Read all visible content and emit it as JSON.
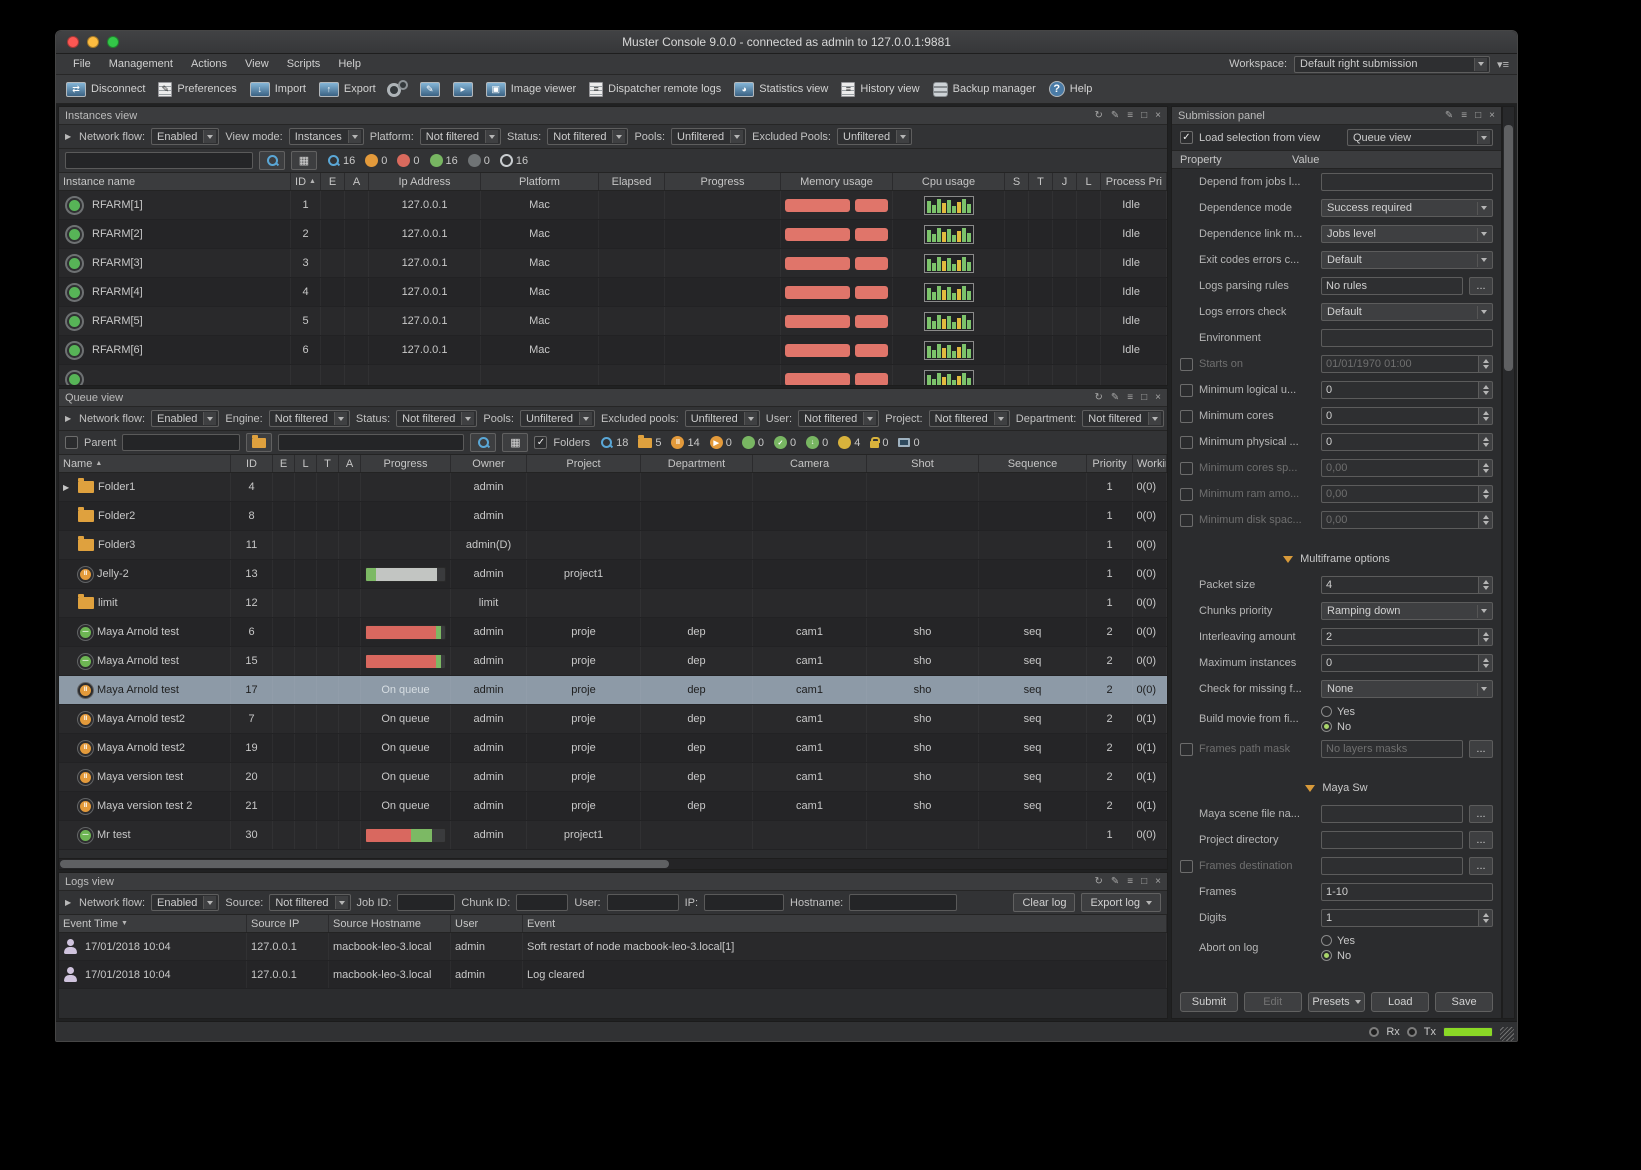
{
  "window": {
    "title": "Muster Console 9.0.0 - connected as admin to 127.0.0.1:9881"
  },
  "colors": {
    "accent_blue": "#5aa7d6",
    "green": "#78b662",
    "yellow": "#e2bb3f",
    "orange": "#dfa13e",
    "red_bar": "#e0756a",
    "progress_red": "#d9685f",
    "selected_row": "#8d9aa7",
    "tx_green": "#8ad926"
  },
  "menubar": {
    "items": [
      "File",
      "Management",
      "Actions",
      "View",
      "Scripts",
      "Help"
    ],
    "workspace_label": "Workspace:",
    "workspace_value": "Default right submission"
  },
  "toolbar": {
    "items": [
      {
        "name": "disconnect",
        "label": "Disconnect",
        "kind": "mon",
        "glyph": "⇄"
      },
      {
        "name": "preferences",
        "label": "Preferences",
        "kind": "page",
        "glyph": "✎"
      },
      {
        "name": "import",
        "label": "Import",
        "kind": "mon",
        "glyph": "↓"
      },
      {
        "name": "export",
        "label": "Export",
        "kind": "mon",
        "glyph": "↑"
      },
      {
        "name": "engine-settings",
        "label": "",
        "kind": "gears",
        "glyph": ""
      },
      {
        "name": "node-editor",
        "label": "",
        "kind": "mon",
        "glyph": "✎"
      },
      {
        "name": "send-command",
        "label": "",
        "kind": "mon",
        "glyph": "▸"
      },
      {
        "name": "image-viewer",
        "label": "Image viewer",
        "kind": "mon",
        "glyph": "▣"
      },
      {
        "name": "dispatcher-remote-logs",
        "label": "Dispatcher remote logs",
        "kind": "page",
        "glyph": "≡"
      },
      {
        "name": "statistics-view",
        "label": "Statistics view",
        "kind": "mon",
        "glyph": "◕"
      },
      {
        "name": "history-view",
        "label": "History view",
        "kind": "page",
        "glyph": "≡"
      },
      {
        "name": "backup-manager",
        "label": "Backup manager",
        "kind": "disks",
        "glyph": ""
      },
      {
        "name": "help",
        "label": "Help",
        "kind": "helpc",
        "glyph": "?"
      }
    ]
  },
  "header_icons": {
    "left_panels": [
      [
        "refresh",
        "↻"
      ],
      [
        "tools",
        "✎"
      ],
      [
        "menu",
        "≡"
      ],
      [
        "maximize",
        "□"
      ],
      [
        "close",
        "×"
      ]
    ],
    "submission": [
      [
        "tools",
        "✎"
      ],
      [
        "menu",
        "≡"
      ],
      [
        "maximize",
        "□"
      ],
      [
        "close",
        "×"
      ]
    ]
  },
  "instances_visuals": {
    "memory_bars": [
      68,
      34
    ],
    "cpu_bars": [
      [
        12,
        "g"
      ],
      [
        8,
        "g"
      ],
      [
        14,
        "g"
      ],
      [
        10,
        "y"
      ],
      [
        13,
        "g"
      ],
      [
        7,
        "g"
      ],
      [
        11,
        "y"
      ],
      [
        14,
        "g"
      ],
      [
        9,
        "g"
      ]
    ]
  },
  "panels": {
    "instances": {
      "title": "Instances view",
      "filters": [
        [
          "Network flow:",
          "Enabled"
        ],
        [
          "View mode:",
          "Instances"
        ],
        [
          "Platform:",
          "Not filtered"
        ],
        [
          "Status:",
          "Not filtered"
        ],
        [
          "Pools:",
          "Unfiltered"
        ],
        [
          "Excluded Pools:",
          "Unfiltered"
        ]
      ],
      "search_value": "",
      "counters": [
        {
          "icon": "search",
          "value": "16"
        },
        {
          "icon": "circle",
          "color": "#e39a3b",
          "value": "0"
        },
        {
          "icon": "circle",
          "color": "#d96a5d",
          "value": "0"
        },
        {
          "icon": "circle",
          "color": "#78b662",
          "value": "16"
        },
        {
          "icon": "circle",
          "color": "#6f7375",
          "value": "0"
        },
        {
          "icon": "circle-outline",
          "color": "#c9cdd0",
          "value": "16"
        }
      ],
      "columns": [
        "Instance name",
        "ID",
        "E",
        "A",
        "Ip Address",
        "Platform",
        "Elapsed",
        "Progress",
        "Memory usage",
        "Cpu usage",
        "S",
        "T",
        "J",
        "L",
        "Process Pri"
      ],
      "rows": [
        {
          "name": "RFARM[1]",
          "id": "1",
          "ip": "127.0.0.1",
          "platform": "Mac",
          "pri": "Idle"
        },
        {
          "name": "RFARM[2]",
          "id": "2",
          "ip": "127.0.0.1",
          "platform": "Mac",
          "pri": "Idle"
        },
        {
          "name": "RFARM[3]",
          "id": "3",
          "ip": "127.0.0.1",
          "platform": "Mac",
          "pri": "Idle"
        },
        {
          "name": "RFARM[4]",
          "id": "4",
          "ip": "127.0.0.1",
          "platform": "Mac",
          "pri": "Idle"
        },
        {
          "name": "RFARM[5]",
          "id": "5",
          "ip": "127.0.0.1",
          "platform": "Mac",
          "pri": "Idle"
        },
        {
          "name": "RFARM[6]",
          "id": "6",
          "ip": "127.0.0.1",
          "platform": "Mac",
          "pri": "Idle"
        },
        {
          "name": "",
          "id": "",
          "ip": "",
          "platform": "",
          "pri": "",
          "partial": true
        }
      ]
    },
    "queue": {
      "title": "Queue view",
      "filters": [
        [
          "Network flow:",
          "Enabled"
        ],
        [
          "Engine:",
          "Not filtered"
        ],
        [
          "Status:",
          "Not filtered"
        ],
        [
          "Pools:",
          "Unfiltered"
        ],
        [
          "Excluded pools:",
          "Unfiltered"
        ],
        [
          "User:",
          "Not filtered"
        ],
        [
          "Project:",
          "Not filtered"
        ],
        [
          "Department:",
          "Not filtered"
        ]
      ],
      "parent_label": "Parent",
      "folders_label": "Folders",
      "counters": [
        {
          "icon": "search",
          "value": "18"
        },
        {
          "icon": "folder",
          "value": "5"
        },
        {
          "icon": "pause",
          "color": "#e39a3b",
          "value": "14"
        },
        {
          "icon": "play",
          "color": "#e39a3b",
          "value": "0"
        },
        {
          "icon": "circle",
          "color": "#78b662",
          "value": "0"
        },
        {
          "icon": "check",
          "color": "#78b662",
          "value": "0"
        },
        {
          "icon": "down",
          "color": "#78b662",
          "value": "0"
        },
        {
          "icon": "circle",
          "color": "#d8b23c",
          "value": "4"
        },
        {
          "icon": "lock",
          "value": "0"
        },
        {
          "icon": "monitor",
          "value": "0"
        }
      ],
      "columns": [
        "Name",
        "ID",
        "E",
        "L",
        "T",
        "A",
        "Progress",
        "Owner",
        "Project",
        "Department",
        "Camera",
        "Shot",
        "Sequence",
        "Priority",
        "Working n"
      ],
      "rows": [
        {
          "icon": "folder",
          "expander": true,
          "name": "Folder1",
          "id": "4",
          "owner": "admin",
          "project": "",
          "department": "",
          "camera": "",
          "shot": "",
          "sequence": "",
          "priority": "1",
          "working": "0(0)"
        },
        {
          "icon": "folder",
          "name": "Folder2",
          "id": "8",
          "owner": "admin",
          "project": "",
          "department": "",
          "camera": "",
          "shot": "",
          "sequence": "",
          "priority": "1",
          "working": "0(0)"
        },
        {
          "icon": "folder",
          "name": "Folder3",
          "id": "11",
          "owner": "admin(D)",
          "project": "",
          "department": "",
          "camera": "",
          "shot": "",
          "sequence": "",
          "priority": "1",
          "working": "0(0)"
        },
        {
          "icon": "pause",
          "name": "Jelly-2",
          "id": "13",
          "progress": {
            "bar": [
              [
                "#7cb964",
                13
              ],
              [
                "#c2c5c2",
                77
              ]
            ]
          },
          "owner": "admin",
          "project": "project1",
          "department": "",
          "camera": "",
          "shot": "",
          "sequence": "",
          "priority": "1",
          "working": "0(0)"
        },
        {
          "icon": "folder",
          "name": "limit",
          "id": "12",
          "owner": "limit",
          "project": "",
          "department": "",
          "camera": "",
          "shot": "",
          "sequence": "",
          "priority": "1",
          "working": "0(0)"
        },
        {
          "icon": "stopped",
          "name": "Maya Arnold test",
          "id": "6",
          "progress": {
            "bar": [
              [
                "#d9685f",
                89
              ],
              [
                "#7cb964",
                6
              ]
            ]
          },
          "owner": "admin",
          "project": "proje",
          "department": "dep",
          "camera": "cam1",
          "shot": "sho",
          "sequence": "seq",
          "priority": "2",
          "working": "0(0)"
        },
        {
          "icon": "stopped",
          "name": "Maya Arnold test",
          "id": "15",
          "progress": {
            "bar": [
              [
                "#d9685f",
                89
              ],
              [
                "#7cb964",
                6
              ]
            ]
          },
          "owner": "admin",
          "project": "proje",
          "department": "dep",
          "camera": "cam1",
          "shot": "sho",
          "sequence": "seq",
          "priority": "2",
          "working": "0(0)"
        },
        {
          "icon": "pause",
          "name": "Maya Arnold test",
          "id": "17",
          "selected": true,
          "progress": {
            "text": "On queue"
          },
          "owner": "admin",
          "project": "proje",
          "department": "dep",
          "camera": "cam1",
          "shot": "sho",
          "sequence": "seq",
          "priority": "2",
          "working": "0(0)"
        },
        {
          "icon": "pause",
          "name": "Maya Arnold test2",
          "id": "7",
          "progress": {
            "text": "On queue"
          },
          "owner": "admin",
          "project": "proje",
          "department": "dep",
          "camera": "cam1",
          "shot": "sho",
          "sequence": "seq",
          "priority": "2",
          "working": "0(1)"
        },
        {
          "icon": "pause",
          "name": "Maya Arnold test2",
          "id": "19",
          "progress": {
            "text": "On queue"
          },
          "owner": "admin",
          "project": "proje",
          "department": "dep",
          "camera": "cam1",
          "shot": "sho",
          "sequence": "seq",
          "priority": "2",
          "working": "0(1)"
        },
        {
          "icon": "pause",
          "name": "Maya version test",
          "id": "20",
          "progress": {
            "text": "On queue"
          },
          "owner": "admin",
          "project": "proje",
          "department": "dep",
          "camera": "cam1",
          "shot": "sho",
          "sequence": "seq",
          "priority": "2",
          "working": "0(1)"
        },
        {
          "icon": "pause",
          "name": "Maya version test 2",
          "id": "21",
          "progress": {
            "text": "On queue"
          },
          "owner": "admin",
          "project": "proje",
          "department": "dep",
          "camera": "cam1",
          "shot": "sho",
          "sequence": "seq",
          "priority": "2",
          "working": "0(1)"
        },
        {
          "icon": "stopped",
          "name": "Mr test",
          "id": "30",
          "progress": {
            "bar": [
              [
                "#d9685f",
                57
              ],
              [
                "#7cb964",
                26
              ]
            ]
          },
          "owner": "admin",
          "project": "project1",
          "department": "",
          "camera": "",
          "shot": "",
          "sequence": "",
          "priority": "1",
          "working": "0(0)"
        }
      ]
    },
    "logs": {
      "title": "Logs view",
      "filter_selects": [
        [
          "Network flow:",
          "Enabled"
        ],
        [
          "Source:",
          "Not filtered"
        ]
      ],
      "filter_inputs": [
        [
          "Job ID:",
          "",
          58
        ],
        [
          "Chunk ID:",
          "",
          52
        ],
        [
          "User:",
          "",
          72
        ],
        [
          "IP:",
          "",
          80
        ],
        [
          "Hostname:",
          "",
          108
        ]
      ],
      "buttons": [
        "Clear log",
        "Export log"
      ],
      "columns": [
        "Event Time",
        "Source IP",
        "Source Hostname",
        "User",
        "Event"
      ],
      "rows": [
        {
          "time": "17/01/2018 10:04",
          "ip": "127.0.0.1",
          "host": "macbook-leo-3.local",
          "user": "admin",
          "event": "Soft restart of node macbook-leo-3.local[1]"
        },
        {
          "time": "17/01/2018 10:04",
          "ip": "127.0.0.1",
          "host": "macbook-leo-3.local",
          "user": "admin",
          "event": "Log cleared"
        }
      ]
    }
  },
  "submission": {
    "title": "Submission panel",
    "load_selection_label": "Load selection from view",
    "view_select": "Queue view",
    "prop_header": "Property",
    "value_header": "Value",
    "groups": [
      {
        "title": "",
        "rows": [
          {
            "label": "Depend from jobs l...",
            "control": "input",
            "value": ""
          },
          {
            "label": "Dependence mode",
            "control": "select",
            "value": "Success required"
          },
          {
            "label": "Dependence link m...",
            "control": "select",
            "value": "Jobs level"
          },
          {
            "label": "Exit codes errors c...",
            "control": "select",
            "value": "Default"
          },
          {
            "label": "Logs parsing rules",
            "control": "input",
            "value": "No rules",
            "browse": true
          },
          {
            "label": "Logs errors check",
            "control": "select",
            "value": "Default"
          },
          {
            "label": "Environment",
            "control": "input",
            "value": ""
          },
          {
            "label": "Starts on",
            "cb": true,
            "control": "spinner",
            "value": "01/01/1970 01:00",
            "dim": true
          },
          {
            "label": "Minimum logical u...",
            "cb": true,
            "control": "spinner",
            "value": "0"
          },
          {
            "label": "Minimum cores",
            "cb": true,
            "control": "spinner",
            "value": "0"
          },
          {
            "label": "Minimum physical ...",
            "cb": true,
            "control": "spinner",
            "value": "0"
          },
          {
            "label": "Minimum cores sp...",
            "cb": true,
            "control": "spinner",
            "value": "0,00",
            "dim": true
          },
          {
            "label": "Minimum ram amo...",
            "cb": true,
            "control": "spinner",
            "value": "0,00",
            "dim": true
          },
          {
            "label": "Minimum disk spac...",
            "cb": true,
            "control": "spinner",
            "value": "0,00",
            "dim": true
          }
        ]
      },
      {
        "title": "Multiframe options",
        "rows": [
          {
            "label": "Packet size",
            "control": "spinner",
            "value": "4"
          },
          {
            "label": "Chunks priority",
            "control": "select",
            "value": "Ramping down"
          },
          {
            "label": "Interleaving amount",
            "control": "spinner",
            "value": "2"
          },
          {
            "label": "Maximum instances",
            "control": "spinner",
            "value": "0"
          },
          {
            "label": "Check for missing f...",
            "control": "select",
            "value": "None"
          },
          {
            "label": "Build movie from fi...",
            "control": "radio",
            "options": [
              "Yes",
              "No"
            ],
            "selected": "No"
          },
          {
            "label": "Frames path mask",
            "cb": true,
            "control": "input",
            "value": "No layers masks",
            "browse": true,
            "dim": true
          }
        ]
      },
      {
        "title": "Maya Sw",
        "rows": [
          {
            "label": "Maya scene file na...",
            "control": "input",
            "value": "",
            "browse": true
          },
          {
            "label": "Project directory",
            "control": "input",
            "value": "",
            "browse": true
          },
          {
            "label": "Frames destination",
            "cb": true,
            "control": "input",
            "value": "",
            "browse": true,
            "dim": true
          },
          {
            "label": "Frames",
            "control": "input",
            "value": "1-10"
          },
          {
            "label": "Digits",
            "control": "spinner",
            "value": "1"
          },
          {
            "label": "Abort on log",
            "control": "radio",
            "options": [
              "Yes",
              "No"
            ],
            "selected": "No"
          }
        ]
      }
    ],
    "buttons": [
      {
        "label": "Submit"
      },
      {
        "label": "Edit",
        "disabled": true
      },
      {
        "label": "Presets",
        "arrow": true
      },
      {
        "label": "Load"
      },
      {
        "label": "Save"
      }
    ]
  },
  "statusbar": {
    "rx": "Rx",
    "tx": "Tx"
  }
}
